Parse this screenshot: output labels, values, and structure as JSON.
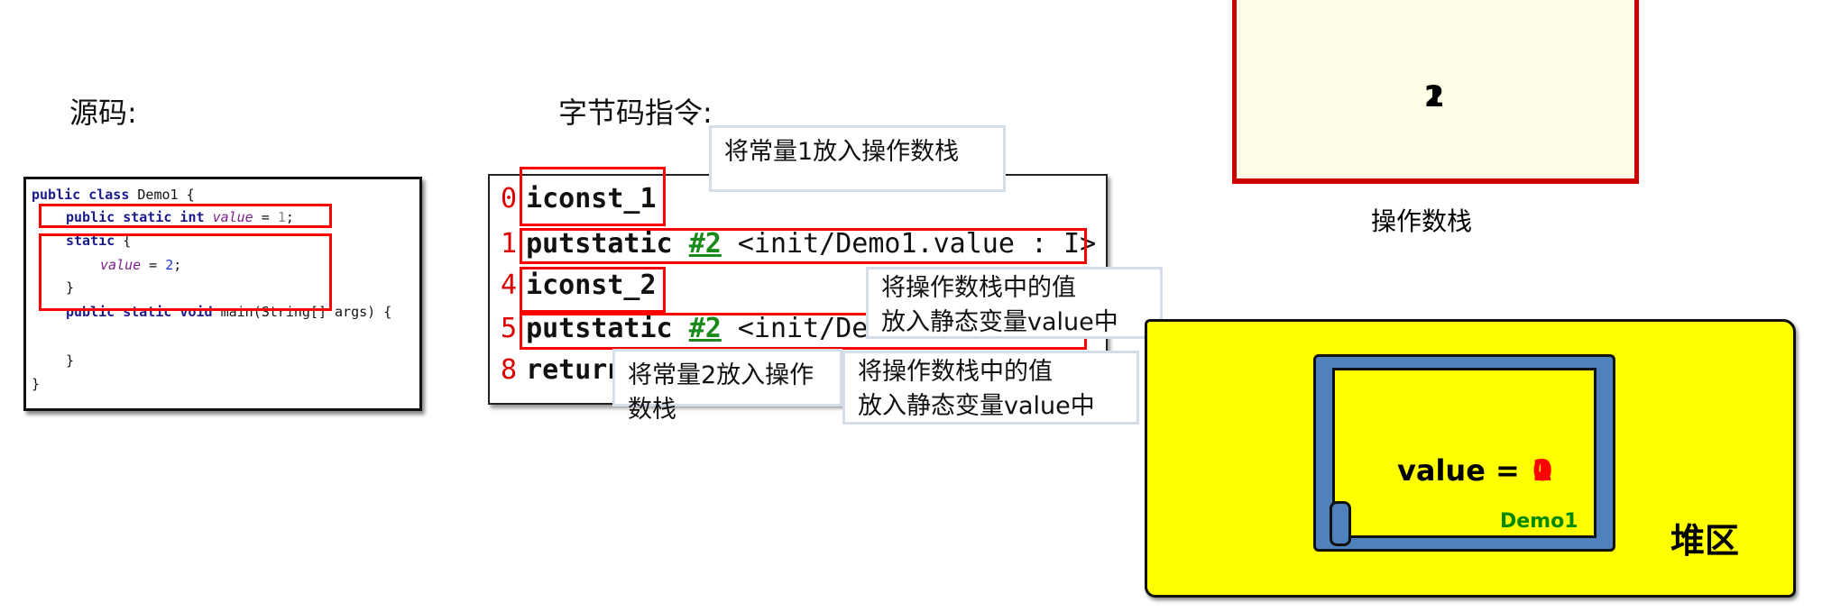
{
  "source": {
    "title": "源码:",
    "lines": [
      {
        "kw": "public class ",
        "text": "Demo1 {"
      },
      {
        "kw": "public static int ",
        "var": "value",
        "eq": " = ",
        "num": "1",
        "end": ";"
      },
      {
        "kw": "static ",
        "text": "{"
      },
      {
        "var": "value",
        "eq": " = ",
        "num": "2",
        "end": ";"
      },
      {
        "text": "}"
      },
      {
        "kw": "public static void ",
        "text": "main(String[] args) {"
      },
      {
        "text": ""
      },
      {
        "text": "}"
      },
      {
        "text": "}"
      }
    ]
  },
  "bytecode": {
    "title": "字节码指令:",
    "instructions": [
      {
        "offset": "0",
        "op": "iconst_1"
      },
      {
        "offset": "1",
        "op": "putstatic",
        "ref": "#2",
        "arg": "<init/Demo1.value : I>"
      },
      {
        "offset": "4",
        "op": "iconst_2"
      },
      {
        "offset": "5",
        "op": "putstatic",
        "ref": "#2",
        "arg": "<init/Demo1.value : I>"
      },
      {
        "offset": "8",
        "op": "return"
      }
    ]
  },
  "callouts": [
    {
      "text": "将常量1放入操作数栈"
    },
    {
      "line1": "将操作数栈中的值",
      "line2": "放入静态变量value中"
    },
    {
      "text": "将常量2放入操作数栈"
    },
    {
      "line1": "将操作数栈中的值",
      "line2": "放入静态变量value中"
    }
  ],
  "operand_stack": {
    "label": "操作数栈",
    "values": [
      "1",
      "2"
    ]
  },
  "heap": {
    "label": "堆区",
    "object": {
      "class": "Demo1",
      "field": "value =",
      "values": [
        "0",
        "1",
        "2"
      ]
    }
  },
  "colors": {
    "highlight": "#ff0000",
    "stack_border": "#cc0000",
    "heap_fill": "#ffff00",
    "object_fill": "#4f81bd",
    "class_name": "#008800"
  }
}
